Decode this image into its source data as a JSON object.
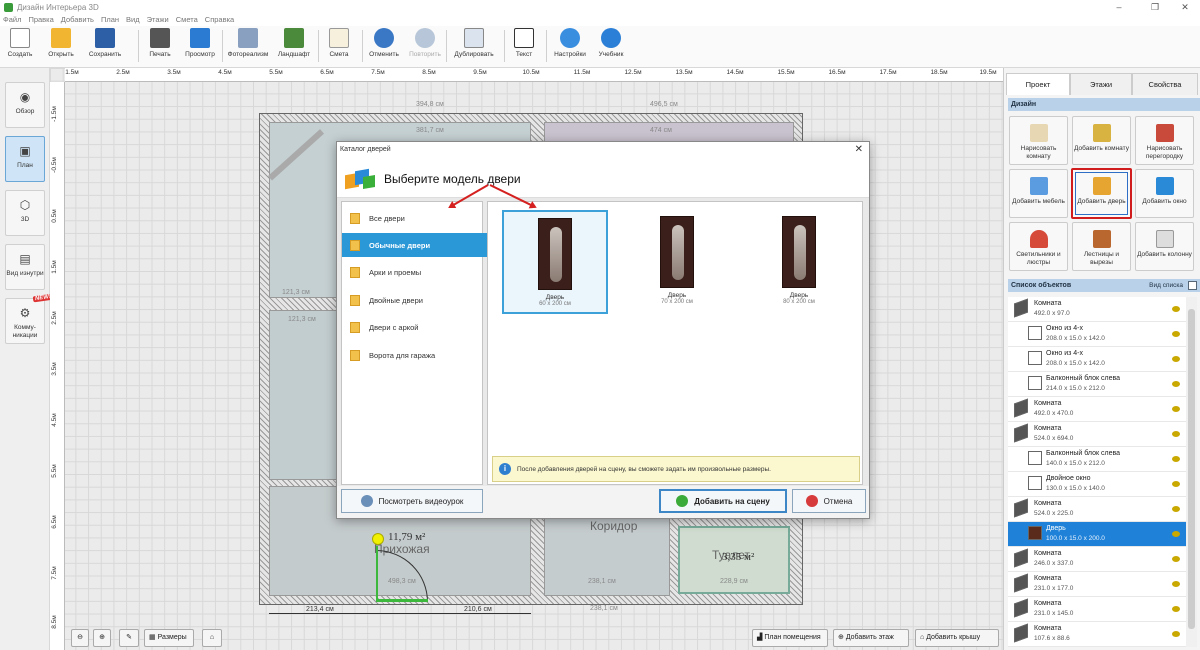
{
  "window": {
    "title": "Дизайн Интерьера 3D",
    "min": "–",
    "max": "❐",
    "close": "✕"
  },
  "menu": [
    "Файл",
    "Правка",
    "Добавить",
    "План",
    "Вид",
    "Этажи",
    "Смета",
    "Справка"
  ],
  "toolbar": {
    "create": "Создать",
    "open": "Открыть",
    "save": "Сохранить",
    "print": "Печать",
    "preview": "Просмотр",
    "photoreal": "Фотореализм",
    "landscape": "Ландшафт",
    "estimate": "Смета",
    "undo": "Отменить",
    "redo": "Повторить",
    "duplicate": "Дублировать",
    "text": "Текст",
    "settings": "Настройки",
    "tutorial": "Учебник"
  },
  "left_tools": {
    "overview": "Обзор",
    "plan": "План",
    "view3d": "3D",
    "inside": "Вид изнутри",
    "comm": "Комму-никации",
    "new_badge": "NEW!"
  },
  "ruler_h": [
    "1.5м",
    "2.5м",
    "3.5м",
    "4.5м",
    "5.5м",
    "6.5м",
    "7.5м",
    "8.5м",
    "9.5м",
    "10.5м",
    "11.5м",
    "12.5м",
    "13.5м",
    "14.5м",
    "15.5м",
    "16.5м",
    "17.5м",
    "18.5м",
    "19.5м"
  ],
  "ruler_v": [
    "-1.5м",
    "-0.5м",
    "0.5м",
    "1.5м",
    "2.5м",
    "3.5м",
    "4.5м",
    "5.5м",
    "6.5м",
    "7.5м",
    "8.5м"
  ],
  "plan": {
    "dim_top1": "394,8 см",
    "dim_top2": "496,5 см",
    "dim_in1": "381,7 см",
    "dim_in2": "474 см",
    "dim_small": "121,3 см",
    "dim_area": "11,79 м²",
    "room_hall": "Прихожая",
    "room_corridor": "Коридор",
    "room_toilet": "Туалет",
    "dim_toilet": "3,35 м²",
    "dim_b1": "213,4 см",
    "dim_b2": "210,6 см",
    "dim_hall_w": "498,3 см",
    "dim_bot_in": "238,1 см",
    "dim_toilet_w": "228,9 см"
  },
  "bottom": {
    "sizes": "Размеры",
    "room_plan": "План помещения",
    "add_floor": "Добавить этаж",
    "add_roof": "Добавить крышу"
  },
  "right": {
    "tab_project": "Проект",
    "tab_floors": "Этажи",
    "tab_props": "Свойства",
    "design": "Дизайн",
    "draw_room": "Нарисовать комнату",
    "add_room": "Добавить комнату",
    "draw_partition": "Нарисовать перегородку",
    "add_furniture": "Добавить мебель",
    "add_door": "Добавить дверь",
    "add_window": "Добавить окно",
    "lamps": "Светильники и люстры",
    "stairs": "Лестницы и вырезы",
    "add_column": "Добавить колонну",
    "obj_list": "Список объектов",
    "view_list": "Вид списка",
    "objects": [
      {
        "name": "Комната",
        "dims": "492.0 x 97.0",
        "sub": false
      },
      {
        "name": "Окно из 4-х",
        "dims": "208.0 x 15.0 x 142.0",
        "sub": true
      },
      {
        "name": "Окно из 4-х",
        "dims": "208.0 x 15.0 x 142.0",
        "sub": true
      },
      {
        "name": "Балконный блок слева",
        "dims": "214.0 x 15.0 x 212.0",
        "sub": true
      },
      {
        "name": "Комната",
        "dims": "492.0 x 470.0",
        "sub": false
      },
      {
        "name": "Комната",
        "dims": "524.0 x 694.0",
        "sub": false
      },
      {
        "name": "Балконный блок слева",
        "dims": "140.0 x 15.0 x 212.0",
        "sub": true
      },
      {
        "name": "Двойное окно",
        "dims": "130.0 x 15.0 x 140.0",
        "sub": true
      },
      {
        "name": "Комната",
        "dims": "524.0 x 225.0",
        "sub": false
      },
      {
        "name": "Дверь",
        "dims": "100.0 x 15.0 x 200.0",
        "sub": true,
        "selected": true
      },
      {
        "name": "Комната",
        "dims": "246.0 x 337.0",
        "sub": false
      },
      {
        "name": "Комната",
        "dims": "231.0 x 177.0",
        "sub": false
      },
      {
        "name": "Комната",
        "dims": "231.0 x 145.0",
        "sub": false
      },
      {
        "name": "Комната",
        "dims": "107.6 x 88.6",
        "sub": false
      }
    ]
  },
  "dialog": {
    "title": "Каталог дверей",
    "close": "✕",
    "heading": "Выберите модель двери",
    "categories": [
      "Все двери",
      "Обычные двери",
      "Арки и проемы",
      "Двойные двери",
      "Двери с аркой",
      "Ворота для гаража"
    ],
    "doors": [
      {
        "name": "Дверь",
        "size": "60 x 200 см"
      },
      {
        "name": "Дверь",
        "size": "70 x 200 см"
      },
      {
        "name": "Дверь",
        "size": "80 x 200 см"
      }
    ],
    "info": "После добавления дверей на сцену, вы сможете задать им произвольные размеры.",
    "video": "Посмотреть видеоурок",
    "add": "Добавить на сцену",
    "cancel": "Отмена"
  }
}
